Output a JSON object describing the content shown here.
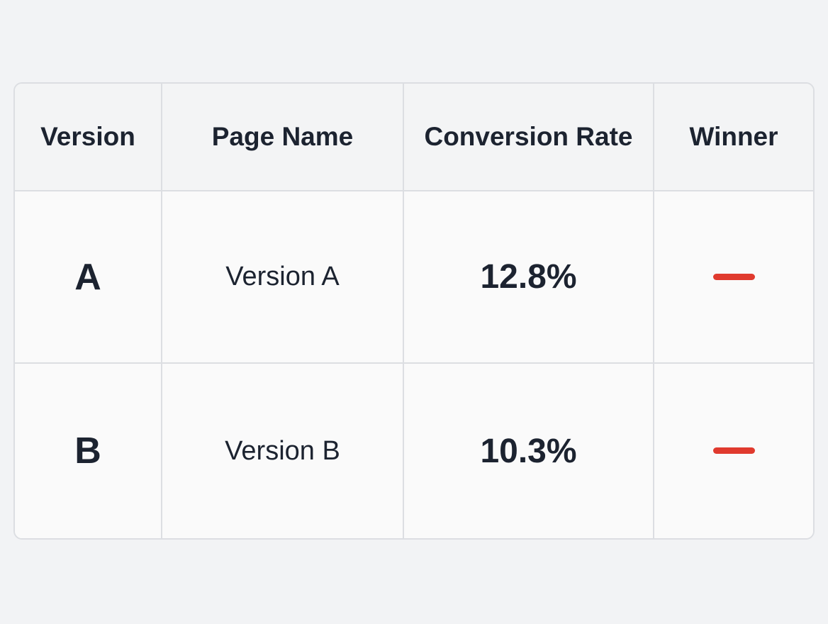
{
  "table": {
    "headers": [
      "Version",
      "Page Name",
      "Conversion Rate",
      "Winner"
    ],
    "rows": [
      {
        "version": "A",
        "page_name": "Version A",
        "conversion_rate": "12.8%",
        "winner": "dash"
      },
      {
        "version": "B",
        "page_name": "Version B",
        "conversion_rate": "10.3%",
        "winner": "dash"
      }
    ]
  },
  "colors": {
    "background": "#f2f3f5",
    "card": "#fafafa",
    "header": "#f3f4f5",
    "border": "#dcdee2",
    "text": "#1c2330",
    "winner_dash": "#e03a2e"
  }
}
